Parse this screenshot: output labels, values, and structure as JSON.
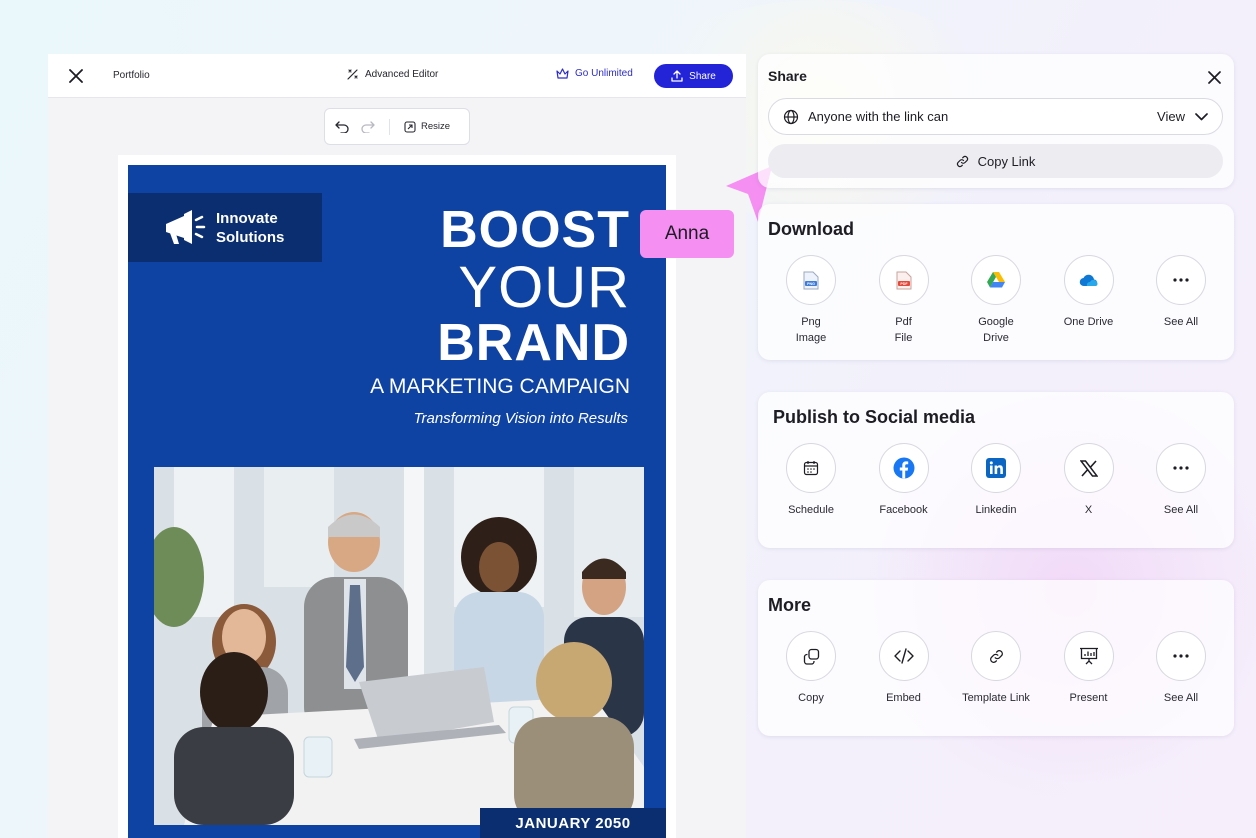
{
  "editor": {
    "title": "Portfolio",
    "advanced_label": "Advanced Editor",
    "unlimited_label": "Go Unlimited",
    "share_label": "Share",
    "resize_label": "Resize"
  },
  "poster": {
    "brand_line1": "Innovate",
    "brand_line2": "Solutions",
    "headline1": "BOOST",
    "headline2": "YOUR",
    "headline3": "BRAND",
    "subheadline": "A MARKETING CAMPAIGN",
    "tagline": "Transforming Vision into Results",
    "date": "JANUARY 2050",
    "colors": {
      "background": "#0f43a3",
      "dark": "#0b2e70"
    }
  },
  "cursor": {
    "user": "Anna",
    "color": "#f58ff2"
  },
  "share_panel": {
    "title": "Share",
    "access_text": "Anyone with the link can",
    "access_permission": "View",
    "copy_link_label": "Copy Link"
  },
  "download": {
    "title": "Download",
    "items": [
      {
        "line1": "Png",
        "line2": "Image",
        "icon": "png-file-icon"
      },
      {
        "line1": "Pdf",
        "line2": "File",
        "icon": "pdf-file-icon"
      },
      {
        "line1": "Google",
        "line2": "Drive",
        "icon": "google-drive-icon"
      },
      {
        "line1": "One Drive",
        "line2": "",
        "icon": "onedrive-icon"
      },
      {
        "line1": "See All",
        "line2": "",
        "icon": "more-icon"
      }
    ]
  },
  "social": {
    "title": "Publish to Social media",
    "items": [
      {
        "label": "Schedule",
        "icon": "calendar-icon"
      },
      {
        "label": "Facebook",
        "icon": "facebook-icon"
      },
      {
        "label": "Linkedin",
        "icon": "linkedin-icon"
      },
      {
        "label": "X",
        "icon": "x-icon"
      },
      {
        "label": "See All",
        "icon": "more-icon"
      }
    ]
  },
  "more": {
    "title": "More",
    "items": [
      {
        "label": "Copy",
        "icon": "copy-icon"
      },
      {
        "label": "Embed",
        "icon": "code-icon"
      },
      {
        "label": "Template Link",
        "icon": "link-icon"
      },
      {
        "label": "Present",
        "icon": "present-icon"
      },
      {
        "label": "See All",
        "icon": "more-icon"
      }
    ]
  },
  "colors": {
    "accent": "#2323d8",
    "facebook": "#1877f2",
    "linkedin": "#0a66c2"
  }
}
